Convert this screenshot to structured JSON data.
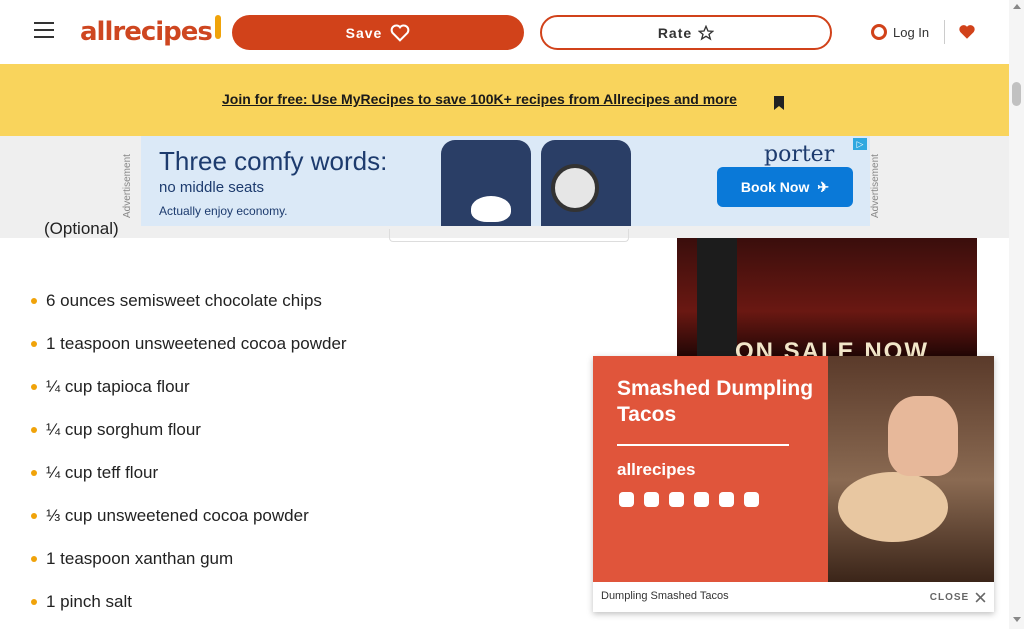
{
  "header": {
    "logo_text": "allrecipes",
    "save_label": "Save",
    "rate_label": "Rate",
    "login_label": "Log In"
  },
  "promo": {
    "link_text": "Join for free: Use MyRecipes to save 100K+ recipes from Allrecipes and more"
  },
  "ad_top": {
    "label": "Advertisement",
    "headline": "Three comfy words:",
    "subline": "no middle seats",
    "tagline": "Actually enjoy economy.",
    "brand": "porter",
    "cta": "Book Now"
  },
  "ingredients": {
    "first_partial": "(Optional)",
    "items": [
      "6 ounces semisweet chocolate chips",
      "1 teaspoon unsweetened cocoa powder",
      "¼ cup tapioca flour",
      "¼ cup sorghum flour",
      "¼ cup teff flour",
      "⅓ cup unsweetened cocoa powder",
      "1 teaspoon xanthan gum",
      "1 pinch salt"
    ]
  },
  "poster": {
    "text": "ON SALE NOW"
  },
  "video_ad": {
    "title": "Smashed Dumpling Tacos",
    "logo_text": "allrecipes",
    "caption": "Dumpling Smashed Tacos",
    "close_label": "CLOSE"
  },
  "colors": {
    "brand": "#ce4620",
    "promo_bg": "#f9d45c",
    "bullet": "#f0a30a"
  },
  "icons": {
    "menu": "hamburger-icon",
    "save": "heart-icon",
    "rate": "star-icon",
    "login": "user-circle-icon",
    "favorite": "heart-icon",
    "promo_close": "bookmark-icon",
    "close": "close-icon"
  }
}
